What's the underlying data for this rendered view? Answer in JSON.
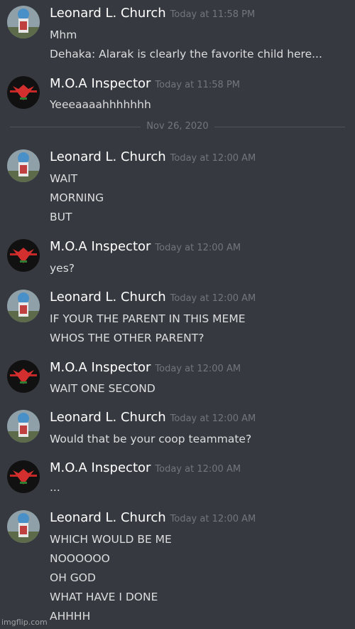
{
  "users": {
    "leonard": {
      "name": "Leonard L. Church",
      "avatar_icon": "caboose-avatar-icon"
    },
    "moa": {
      "name": "M.O.A Inspector",
      "avatar_icon": "arstotzka-eagle-avatar-icon"
    }
  },
  "date_divider": "Nov 26, 2020",
  "messages": [
    {
      "author": "Leonard L. Church",
      "time": "Today at 11:58 PM",
      "lines": [
        "Mhm",
        "Dehaka: Alarak is clearly the favorite child here..."
      ]
    },
    {
      "author": "M.O.A Inspector",
      "time": "Today at 11:58 PM",
      "lines": [
        "Yeeeaaaahhhhhhh"
      ]
    },
    {
      "author": "Leonard L. Church",
      "time": "Today at 12:00 AM",
      "lines": [
        "WAIT",
        "MORNING",
        "BUT"
      ]
    },
    {
      "author": "M.O.A Inspector",
      "time": "Today at 12:00 AM",
      "lines": [
        "yes?"
      ]
    },
    {
      "author": "Leonard L. Church",
      "time": "Today at 12:00 AM",
      "lines": [
        "IF YOUR THE PARENT IN THIS MEME",
        "WHOS THE OTHER PARENT?"
      ]
    },
    {
      "author": "M.O.A Inspector",
      "time": "Today at 12:00 AM",
      "lines": [
        "WAIT ONE SECOND"
      ]
    },
    {
      "author": "Leonard L. Church",
      "time": "Today at 12:00 AM",
      "lines": [
        "Would that be your coop teammate?"
      ]
    },
    {
      "author": "M.O.A Inspector",
      "time": "Today at 12:00 AM",
      "lines": [
        "..."
      ]
    },
    {
      "author": "Leonard L. Church",
      "time": "Today at 12:00 AM",
      "lines": [
        "WHICH WOULD BE ME",
        "NOOOOOO",
        "OH GOD",
        "WHAT HAVE I DONE",
        "AHHHH"
      ]
    }
  ],
  "watermark": "imgflip.com",
  "colors": {
    "background": "#36393f",
    "username": "#ffffff",
    "timestamp": "#72767d",
    "text": "#dcddde",
    "divider": "#4f545c"
  }
}
